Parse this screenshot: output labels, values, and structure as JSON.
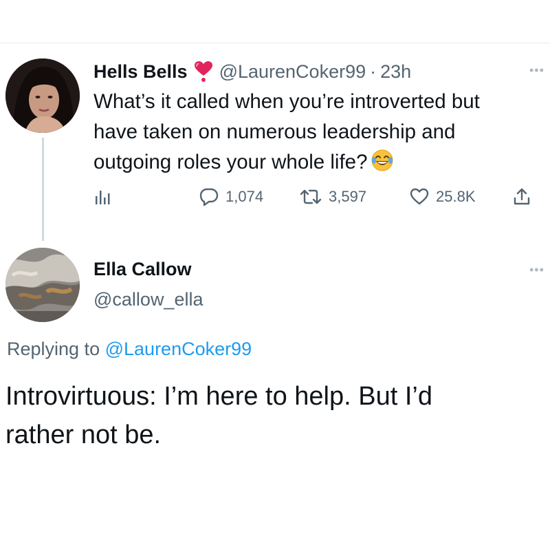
{
  "tweet1": {
    "author_name": "Hells Bells",
    "handle": "@LaurenCoker99",
    "separator": "·",
    "time": "23h",
    "text_lines": [
      "What’s it called when you’re introverted but",
      "have taken on numerous leadership and",
      "outgoing roles your whole life?"
    ],
    "emoji": "face-with-tears-of-joy",
    "replies": "1,074",
    "retweets": "3,597",
    "likes": "25.8K"
  },
  "tweet2": {
    "author_name": "Ella Callow",
    "handle": "@callow_ella",
    "replying_prefix": "Replying to",
    "replying_to": "@LaurenCoker99",
    "text_lines": [
      "Introvirtuous: I’m here to help. But I’d",
      "rather not be."
    ]
  },
  "colors": {
    "text": "#0f1419",
    "secondary": "#536471",
    "link": "#1d9bf0",
    "heart_badge": "#e0245e"
  }
}
